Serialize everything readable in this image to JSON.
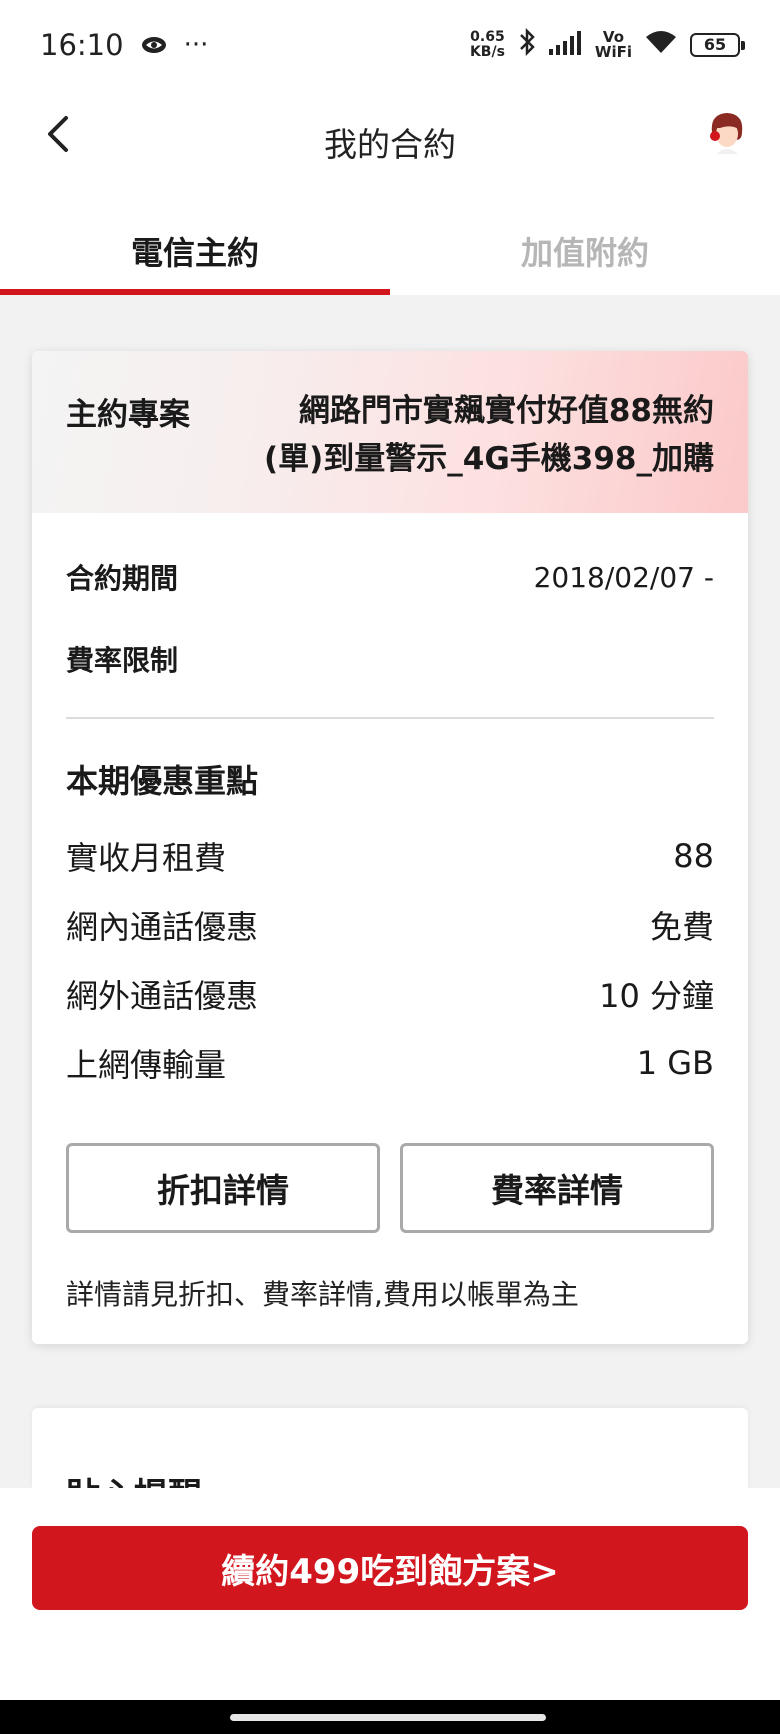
{
  "status_bar": {
    "time": "16:10",
    "more": "···",
    "net_speed_value": "0.65",
    "net_speed_unit": "KB/s",
    "vo": "Vo",
    "wifi_label": "WiFi",
    "battery": "65"
  },
  "header": {
    "title": "我的合約"
  },
  "tabs": [
    {
      "label": "電信主約",
      "active": true
    },
    {
      "label": "加值附約",
      "active": false
    }
  ],
  "contract": {
    "plan_label": "主約專案",
    "plan_name_line1": "網路門市實飆實付好值88無約",
    "plan_name_line2": "(單)到量警示_4G手機398_加購",
    "period_label": "合約期間",
    "period_value": "2018/02/07 -",
    "rate_limit_label": "費率限制",
    "rate_limit_value": "",
    "benefits_title": "本期優惠重點",
    "benefits": [
      {
        "label": "實收月租費",
        "value": "88"
      },
      {
        "label": "網內通話優惠",
        "value": "免費"
      },
      {
        "label": "網外通話優惠",
        "value": "10 分鐘"
      },
      {
        "label": "上網傳輸量",
        "value": "1 GB"
      }
    ],
    "discount_button": "折扣詳情",
    "rate_button": "費率詳情",
    "note": "詳情請見折扣、費率詳情,費用以帳單為主"
  },
  "second_card": {
    "title": "貼心提醒"
  },
  "cta": {
    "label": "續約499吃到飽方案>"
  },
  "colors": {
    "brand_red": "#d2161e",
    "inactive_tab": "#b6b6b6"
  }
}
